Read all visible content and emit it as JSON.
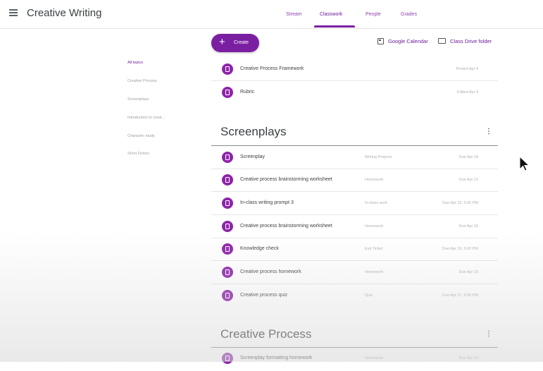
{
  "header": {
    "title": "Creative Writing",
    "tabs": [
      {
        "label": "Stream",
        "active": false
      },
      {
        "label": "Classwork",
        "active": true
      },
      {
        "label": "People",
        "active": false
      },
      {
        "label": "Grades",
        "active": false
      }
    ]
  },
  "toolbar": {
    "create_label": "Create",
    "calendar_label": "Google Calendar",
    "drive_label": "Class Drive folder"
  },
  "topics": [
    {
      "label": "All topics",
      "active": true
    },
    {
      "label": "Creative Process",
      "active": false
    },
    {
      "label": "Screenplays",
      "active": false
    },
    {
      "label": "Introduction to creat...",
      "active": false
    },
    {
      "label": "Character study",
      "active": false
    },
    {
      "label": "Short Fiction",
      "active": false
    }
  ],
  "top_items": [
    {
      "title": "Creative Process Framework",
      "date": "Posted Apr 4"
    },
    {
      "title": "Rubric",
      "date": "Edited Apr 4"
    }
  ],
  "sections": [
    {
      "title": "Screenplays",
      "menu": "⋮",
      "items": [
        {
          "title": "Screenplay",
          "category": "Writing Projects",
          "due": "Due Apr 18"
        },
        {
          "title": "Creative process brainstorming worksheet",
          "category": "Homework",
          "due": "Due Apr 13"
        },
        {
          "title": "In-class writing prompt 3",
          "category": "In-class work",
          "due": "Due Apr 15, 5:00 PM"
        },
        {
          "title": "Creative process brainstorming worksheet",
          "category": "Homework",
          "due": "Due Apr 16"
        },
        {
          "title": "Knowledge check",
          "category": "Exit Ticket",
          "due": "Due Apr 15, 5:00 PM"
        },
        {
          "title": "Creative process homework",
          "category": "Homework",
          "due": "Due Apr 15"
        },
        {
          "title": "Creative process quiz",
          "category": "Quiz",
          "due": "Due Apr 17, 5:00 PM"
        }
      ]
    },
    {
      "title": "Creative Process",
      "menu": "⋮",
      "items": [
        {
          "title": "Screenplay formatting homework",
          "category": "Homework",
          "due": "Due Apr 16"
        }
      ]
    }
  ],
  "colors": {
    "accent": "#7b1fa2",
    "icon": "#8e24aa"
  },
  "icons": {
    "menu": "hamburger-menu-icon",
    "create": "plus-icon",
    "calendar": "calendar-icon",
    "drive": "folder-icon",
    "assignment": "assignment-icon",
    "cursor": "mouse-cursor-icon"
  }
}
